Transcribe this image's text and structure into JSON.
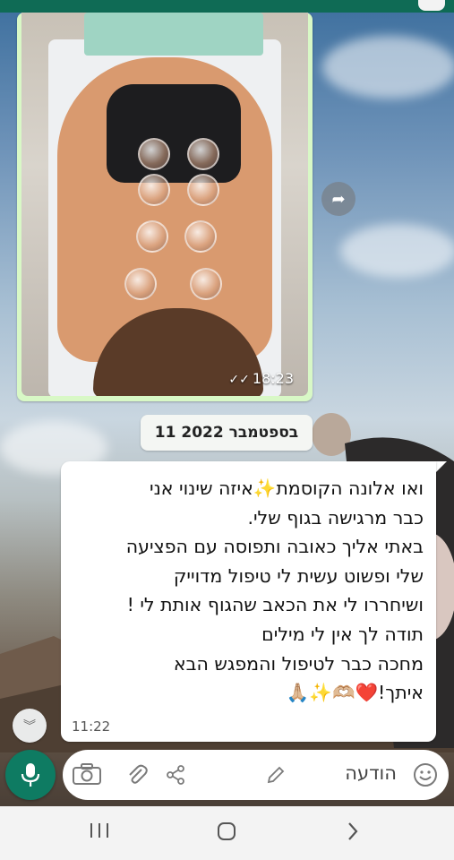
{
  "image_message": {
    "time": "18:23",
    "status_icon": "double-check-icon"
  },
  "date_chip": "11 בספטמבר 2022",
  "text_message": {
    "lines": [
      "ואו אלונה הקוסמת✨איזה שינוי אני",
      "כבר מרגישה בגוף שלי.",
      "באתי אליך כאובה ותפוסה עם הפציעה",
      "שלי ופשוט עשית לי טיפול מדוייק",
      "ושיחררו לי את הכאב שהגוף אותת לי !",
      "תודה לך אין לי מילים",
      "מחכה כבר לטיפול והמפגש הבא",
      "איתך!❤️🫶🏼✨🙏🏼"
    ],
    "time": "11:22"
  },
  "composer": {
    "placeholder": "הודעה"
  },
  "colors": {
    "accent": "#0e7b62",
    "status_bar": "#0f6b55",
    "image_bubble": "#d8f8c6",
    "bubble": "#ffffff"
  }
}
